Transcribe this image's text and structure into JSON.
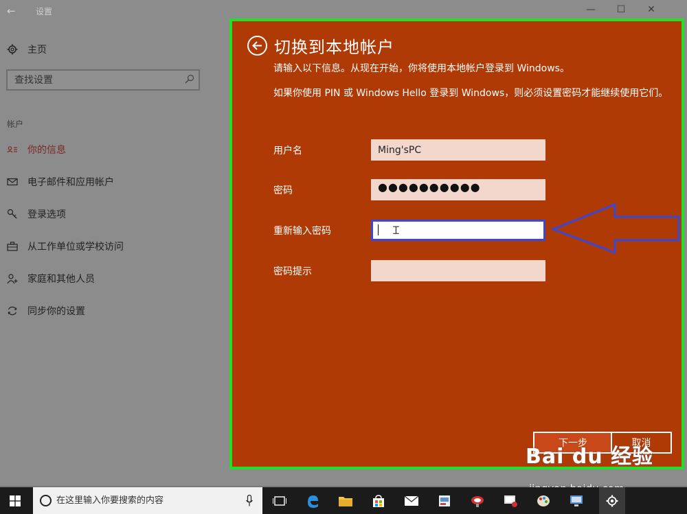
{
  "settings": {
    "title": "设置",
    "home_label": "主页",
    "search_placeholder": "查找设置",
    "section_label": "帐户",
    "nav_items": [
      {
        "label": "你的信息",
        "icon": "person-card-icon",
        "active": true
      },
      {
        "label": "电子邮件和应用帐户",
        "icon": "mail-icon",
        "active": false
      },
      {
        "label": "登录选项",
        "icon": "key-icon",
        "active": false
      },
      {
        "label": "从工作单位或学校访问",
        "icon": "briefcase-icon",
        "active": false
      },
      {
        "label": "家庭和其他人员",
        "icon": "person-add-icon",
        "active": false
      },
      {
        "label": "同步你的设置",
        "icon": "sync-icon",
        "active": false
      }
    ]
  },
  "dialog": {
    "title": "切换到本地帐户",
    "info1": "请输入以下信息。从现在开始，你将使用本地帐户登录到 Windows。",
    "info2": "如果你使用 PIN 或 Windows Hello 登录到 Windows，则必须设置密码才能继续使用它们。",
    "fields": {
      "username": {
        "label": "用户名",
        "value": "Ming'sPC"
      },
      "password": {
        "label": "密码",
        "value": "●●●●●●●●●●"
      },
      "confirm_password": {
        "label": "重新输入密码",
        "value": ""
      },
      "password_hint": {
        "label": "密码提示",
        "value": ""
      }
    },
    "next_label": "下一步",
    "cancel_label": "取消"
  },
  "taskbar": {
    "search_placeholder": "在这里输入你要搜索的内容"
  },
  "watermark": {
    "brand": "Bai du 经验",
    "url": "jingyan.baidu.com"
  },
  "colors": {
    "dialog_bg": "#b03a06",
    "highlight_border": "#22e02a",
    "annotation_arrow": "#3a48d6",
    "input_bg": "#f3d7cc"
  }
}
